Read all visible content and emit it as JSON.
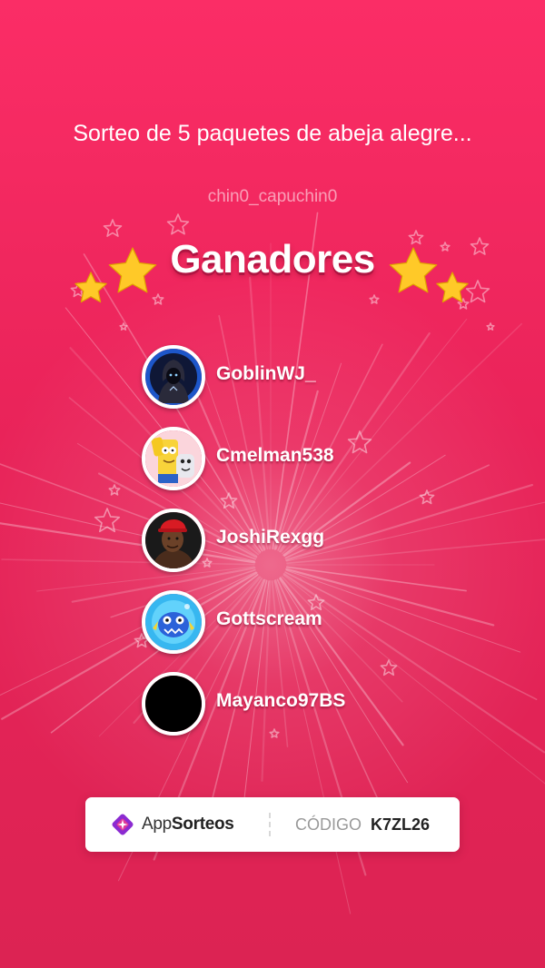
{
  "raffle": {
    "title": "Sorteo de 5 paquetes de abeja alegre...",
    "host": "chin0_capuchin0",
    "heading": "Ganadores"
  },
  "winners": [
    {
      "name": "GoblinWJ_",
      "avatar": "hooded-figure-avatar"
    },
    {
      "name": "Cmelman538",
      "avatar": "cartoon-characters-avatar"
    },
    {
      "name": "JoshiRexgg",
      "avatar": "man-red-cap-avatar"
    },
    {
      "name": "Gottscream",
      "avatar": "blue-monster-avatar"
    },
    {
      "name": "Mayanco97BS",
      "avatar": "black-avatar"
    }
  ],
  "footer": {
    "brand_prefix": "App",
    "brand_suffix": "Sorteos",
    "code_label": "CÓDIGO",
    "code_value": "K7ZL26"
  },
  "colors": {
    "background_top": "#fb2d66",
    "background_bottom": "#dc2353",
    "star_gold": "#ffc928",
    "brand_purple": "#8b2bd1",
    "brand_pink": "#e0399a"
  }
}
